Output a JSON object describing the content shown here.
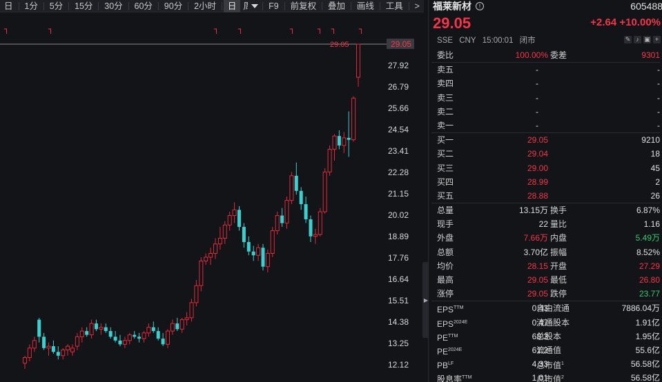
{
  "toolbar": {
    "periods": [
      "日",
      "1分",
      "5分",
      "15分",
      "30分",
      "60分",
      "90分",
      "2小时",
      "日",
      "周"
    ],
    "active_period": "日",
    "tools": [
      "F9",
      "前复权",
      "叠加",
      "画线",
      "工具"
    ],
    "more": ">"
  },
  "stock": {
    "name": "福莱新材",
    "code": "605488",
    "price": "29.05",
    "change": "+2.64",
    "change_pct": "+10.00%",
    "exchange": "SSE",
    "currency": "CNY",
    "time": "15:00:01",
    "status": "闭市"
  },
  "orderbook": {
    "wei_bi_label": "委比",
    "wei_bi": "100.00%",
    "wei_cha_label": "委差",
    "wei_cha": "9301",
    "asks": [
      {
        "label": "卖五",
        "price": "-",
        "vol": "-"
      },
      {
        "label": "卖四",
        "price": "-",
        "vol": "-"
      },
      {
        "label": "卖三",
        "price": "-",
        "vol": "-"
      },
      {
        "label": "卖二",
        "price": "-",
        "vol": "-"
      },
      {
        "label": "卖一",
        "price": "-",
        "vol": "-"
      }
    ],
    "bids": [
      {
        "label": "买一",
        "price": "29.05",
        "vol": "9210"
      },
      {
        "label": "买二",
        "price": "29.04",
        "vol": "18"
      },
      {
        "label": "买三",
        "price": "29.00",
        "vol": "45"
      },
      {
        "label": "买四",
        "price": "28.99",
        "vol": "2"
      },
      {
        "label": "买五",
        "price": "28.88",
        "vol": "26"
      }
    ]
  },
  "stats": [
    {
      "l1": "总量",
      "v1": "13.15万",
      "c1": "white",
      "l2": "换手",
      "v2": "6.87%",
      "c2": "white"
    },
    {
      "l1": "现手",
      "v1": "22",
      "c1": "white",
      "l2": "量比",
      "v2": "1.16",
      "c2": "white"
    },
    {
      "l1": "外盘",
      "v1": "7.66万",
      "c1": "red",
      "l2": "内盘",
      "v2": "5.49万",
      "c2": "green"
    },
    {
      "l1": "总额",
      "v1": "3.70亿",
      "c1": "white",
      "l2": "振幅",
      "v2": "8.52%",
      "c2": "white"
    },
    {
      "l1": "均价",
      "v1": "28.15",
      "c1": "red",
      "l2": "开盘",
      "v2": "27.29",
      "c2": "red"
    },
    {
      "l1": "最高",
      "v1": "29.05",
      "c1": "red",
      "l2": "最低",
      "v2": "26.80",
      "c2": "red"
    },
    {
      "l1": "涨停",
      "v1": "29.05",
      "c1": "red",
      "l2": "跌停",
      "v2": "23.77",
      "c2": "green"
    }
  ],
  "fundamentals": [
    {
      "l1": "EPS",
      "s1": "TTM",
      "v1": "0.43",
      "l2": "自由流通",
      "s2": "",
      "v2": "7886.04万"
    },
    {
      "l1": "EPS",
      "s1": "2024E",
      "v1": "0.47",
      "l2": "流通股本",
      "s2": "",
      "v2": "1.91亿"
    },
    {
      "l1": "PE",
      "s1": "TTM",
      "v1": "68.3",
      "l2": "总股本",
      "s2": "",
      "v2": "1.95亿"
    },
    {
      "l1": "PE",
      "s1": "2024E",
      "v1": "61.2",
      "l2": "流通值",
      "s2": "",
      "v2": "55.6亿"
    },
    {
      "l1": "PB",
      "s1": "LF",
      "v1": "4.33",
      "l2": "总市值",
      "s2": "1",
      "v2": "56.58亿"
    },
    {
      "l1": "股息率",
      "s1": "TTM",
      "v1": "1.01",
      "l2": "总市值",
      "s2": "2",
      "v2": "56.58亿"
    }
  ],
  "chart_data": {
    "type": "candlestick",
    "y_ticks": [
      "29.05",
      "27.92",
      "26.79",
      "25.66",
      "24.54",
      "23.41",
      "22.28",
      "21.15",
      "20.02",
      "18.89",
      "17.76",
      "16.64",
      "15.51",
      "14.38",
      "13.25",
      "12.12"
    ],
    "last_price_label": "29.05",
    "last_price_marker": "29.05",
    "ylim": [
      11.6,
      29.5
    ],
    "colors": {
      "up": "#e6283b",
      "down": "#3ad0d0",
      "price_line": "#8a8a8a",
      "marker": "#f5344a"
    },
    "candles": [
      [
        12.2,
        12.6,
        11.9,
        12.5
      ],
      [
        12.5,
        13.2,
        12.3,
        13.0
      ],
      [
        13.0,
        13.6,
        12.8,
        13.4
      ],
      [
        14.5,
        14.6,
        13.3,
        13.6
      ],
      [
        13.6,
        13.8,
        12.9,
        13.0
      ],
      [
        13.0,
        13.3,
        12.6,
        13.1
      ],
      [
        13.1,
        13.4,
        12.7,
        12.8
      ],
      [
        12.8,
        13.1,
        12.4,
        12.6
      ],
      [
        12.6,
        13.0,
        12.4,
        12.9
      ],
      [
        12.9,
        13.2,
        12.6,
        13.1
      ],
      [
        12.8,
        13.2,
        12.6,
        13.0
      ],
      [
        13.1,
        13.8,
        12.9,
        13.6
      ],
      [
        13.6,
        14.1,
        13.3,
        13.9
      ],
      [
        13.9,
        14.1,
        13.6,
        13.7
      ],
      [
        13.7,
        14.5,
        13.5,
        14.3
      ],
      [
        14.3,
        14.5,
        13.9,
        14.0
      ],
      [
        14.0,
        14.3,
        13.7,
        14.1
      ],
      [
        14.1,
        14.3,
        13.8,
        13.9
      ],
      [
        13.9,
        14.1,
        13.5,
        13.6
      ],
      [
        13.6,
        13.9,
        13.3,
        13.4
      ],
      [
        13.4,
        13.7,
        13.1,
        13.2
      ],
      [
        13.2,
        13.6,
        13.0,
        13.4
      ],
      [
        13.4,
        13.8,
        13.2,
        13.7
      ],
      [
        13.7,
        13.9,
        13.5,
        13.6
      ],
      [
        13.6,
        13.8,
        13.3,
        13.5
      ],
      [
        13.5,
        13.9,
        13.3,
        13.8
      ],
      [
        13.8,
        14.3,
        13.6,
        14.1
      ],
      [
        14.1,
        14.4,
        13.8,
        13.9
      ],
      [
        13.9,
        14.1,
        13.4,
        13.5
      ],
      [
        13.5,
        13.8,
        13.1,
        13.2
      ],
      [
        13.2,
        14.0,
        13.0,
        13.9
      ],
      [
        13.9,
        14.5,
        13.7,
        14.3
      ],
      [
        14.3,
        14.6,
        13.9,
        14.0
      ],
      [
        14.0,
        14.6,
        13.8,
        14.5
      ],
      [
        14.5,
        14.9,
        14.2,
        14.6
      ],
      [
        14.6,
        15.6,
        14.4,
        15.4
      ],
      [
        15.4,
        16.6,
        15.2,
        16.3
      ],
      [
        16.3,
        17.8,
        16.0,
        17.6
      ],
      [
        17.6,
        18.0,
        17.4,
        17.8
      ],
      [
        17.8,
        18.3,
        17.4,
        18.0
      ],
      [
        18.0,
        18.8,
        17.7,
        18.5
      ],
      [
        18.5,
        19.4,
        18.2,
        18.8
      ],
      [
        18.8,
        19.7,
        18.5,
        19.5
      ],
      [
        19.5,
        20.2,
        19.2,
        20.0
      ],
      [
        20.0,
        20.7,
        19.6,
        20.3
      ],
      [
        20.3,
        20.5,
        19.2,
        19.4
      ],
      [
        19.4,
        19.6,
        18.3,
        18.6
      ],
      [
        18.6,
        18.9,
        17.9,
        18.1
      ],
      [
        18.1,
        18.4,
        17.6,
        17.9
      ],
      [
        17.9,
        18.5,
        17.6,
        18.3
      ],
      [
        18.3,
        18.5,
        17.1,
        17.3
      ],
      [
        17.3,
        18.2,
        17.0,
        18.0
      ],
      [
        18.0,
        19.4,
        17.8,
        19.2
      ],
      [
        19.2,
        20.2,
        19.0,
        20.0
      ],
      [
        20.0,
        20.4,
        19.4,
        19.6
      ],
      [
        19.6,
        21.0,
        19.3,
        20.8
      ],
      [
        20.8,
        22.3,
        20.6,
        22.1
      ],
      [
        22.1,
        22.8,
        21.1,
        21.3
      ],
      [
        21.3,
        21.5,
        20.3,
        20.6
      ],
      [
        20.6,
        21.0,
        19.6,
        19.8
      ],
      [
        19.8,
        20.0,
        18.6,
        18.9
      ],
      [
        18.9,
        19.3,
        18.5,
        19.0
      ],
      [
        19.0,
        20.4,
        18.9,
        20.2
      ],
      [
        20.2,
        22.5,
        20.1,
        22.3
      ],
      [
        22.3,
        23.7,
        22.1,
        23.5
      ],
      [
        23.5,
        24.3,
        22.9,
        24.2
      ],
      [
        24.2,
        24.5,
        23.5,
        23.7
      ],
      [
        23.7,
        24.4,
        23.3,
        24.1
      ],
      [
        24.1,
        25.5,
        23.1,
        24.0
      ],
      [
        24.0,
        26.3,
        23.9,
        26.2
      ],
      [
        27.3,
        29.05,
        26.8,
        29.05
      ]
    ],
    "markers_top": [
      "┐",
      "┐",
      "┐",
      "┐",
      "┐",
      "┐",
      "┐",
      "┐"
    ]
  }
}
